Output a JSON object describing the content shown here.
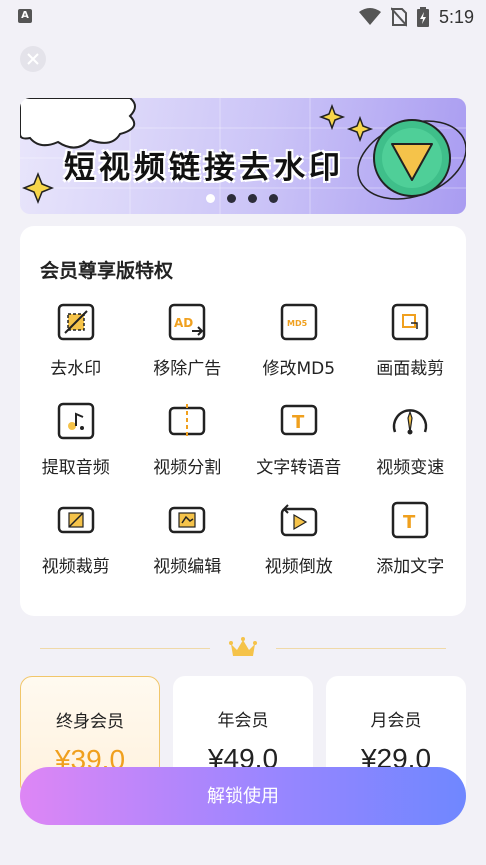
{
  "status_bar": {
    "time": "5:19",
    "app_icon": "A"
  },
  "banner": {
    "title": "短视频链接去水印",
    "dots": 4,
    "active_dot": 0
  },
  "privileges": {
    "title": "会员尊享版特权",
    "features": [
      {
        "label": "去水印",
        "icon": "remove-watermark-icon"
      },
      {
        "label": "移除广告",
        "icon": "remove-ad-icon"
      },
      {
        "label": "修改MD5",
        "icon": "md5-icon"
      },
      {
        "label": "画面裁剪",
        "icon": "crop-frame-icon"
      },
      {
        "label": "提取音频",
        "icon": "extract-audio-icon"
      },
      {
        "label": "视频分割",
        "icon": "video-split-icon"
      },
      {
        "label": "文字转语音",
        "icon": "text-to-speech-icon"
      },
      {
        "label": "视频变速",
        "icon": "speed-gauge-icon"
      },
      {
        "label": "视频裁剪",
        "icon": "video-crop-icon"
      },
      {
        "label": "视频编辑",
        "icon": "video-edit-icon"
      },
      {
        "label": "视频倒放",
        "icon": "video-reverse-icon"
      },
      {
        "label": "添加文字",
        "icon": "add-text-icon"
      }
    ]
  },
  "plans": [
    {
      "name": "终身会员",
      "price": "¥39.0",
      "selected": true
    },
    {
      "name": "年会员",
      "price": "¥49.0",
      "selected": false
    },
    {
      "name": "月会员",
      "price": "¥29.0",
      "selected": false
    }
  ],
  "cta": {
    "label": "解锁使用"
  },
  "colors": {
    "accent_gold": "#f0a01e",
    "icon_gold": "#f5c34a",
    "cta_start": "#de86f5",
    "cta_end": "#6f87ff"
  }
}
